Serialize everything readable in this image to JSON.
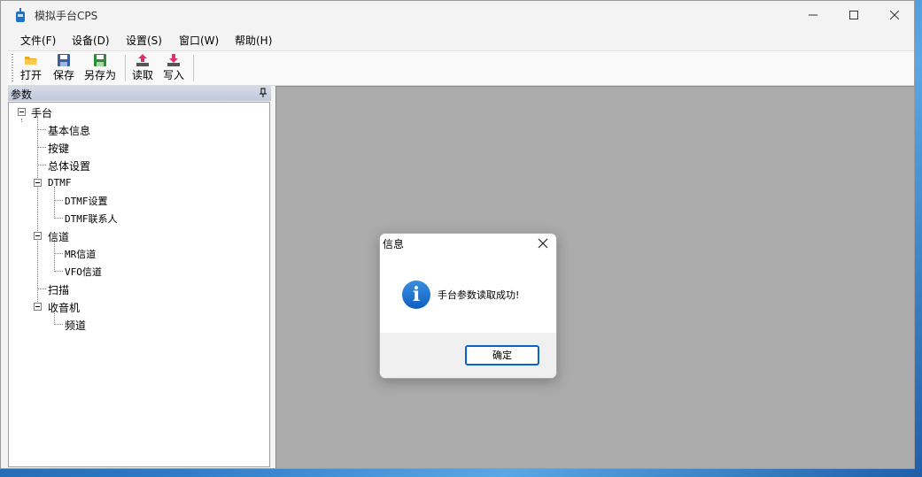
{
  "window": {
    "title": "模拟手台CPS"
  },
  "menu": [
    "文件(F)",
    "设备(D)",
    "设置(S)",
    "窗口(W)",
    "帮助(H)"
  ],
  "toolbar": {
    "open": "打开",
    "save": "保存",
    "save_as": "另存为",
    "read": "读取",
    "write": "写入"
  },
  "panel": {
    "title": "参数"
  },
  "tree": {
    "root": "手台",
    "basic_info": "基本信息",
    "keys": "按键",
    "general": "总体设置",
    "dtmf": "DTMF",
    "dtmf_settings": "DTMF设置",
    "dtmf_contacts": "DTMF联系人",
    "channels": "信道",
    "mr_channels": "MR信道",
    "vfo_channels": "VFO信道",
    "scan": "扫描",
    "radio": "收音机",
    "frequency": "频道"
  },
  "dialog": {
    "title": "信息",
    "message": "手台参数读取成功!",
    "ok": "确定"
  },
  "colors": {
    "accent": "#0a64c8",
    "mdi_bg": "#ababab",
    "panel_head": "#c8cfe0"
  }
}
